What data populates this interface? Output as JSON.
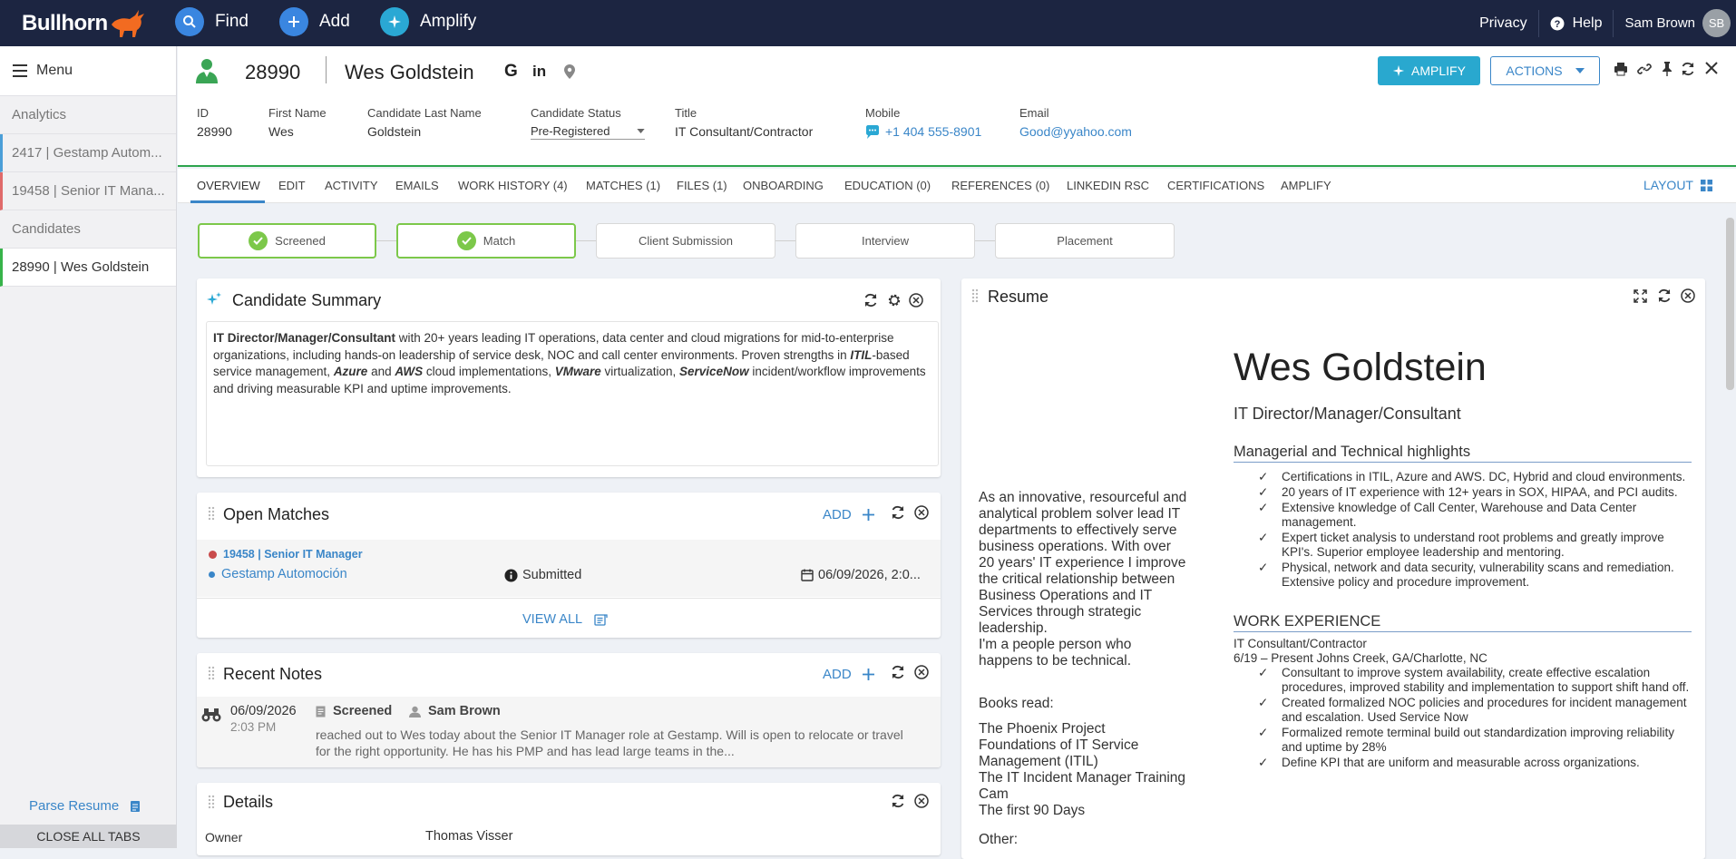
{
  "topbar": {
    "logo": "Bullhorn",
    "find": "Find",
    "add": "Add",
    "amplify": "Amplify",
    "privacy": "Privacy",
    "help": "Help",
    "user_name": "Sam Brown",
    "user_initials": "SB"
  },
  "sidebar": {
    "menu": "Menu",
    "items": [
      {
        "label": "Analytics"
      },
      {
        "label": "2417 | Gestamp Autom..."
      },
      {
        "label": "19458 | Senior IT Mana..."
      },
      {
        "label": "Candidates"
      },
      {
        "label": "28990 | Wes Goldstein"
      }
    ],
    "parse_resume": "Parse Resume",
    "close_all_tabs": "CLOSE ALL TABS"
  },
  "record": {
    "id": "28990",
    "name": "Wes Goldstein",
    "amplify_button": "AMPLIFY",
    "actions_button": "ACTIONS",
    "fields": [
      {
        "label": "ID",
        "value": "28990"
      },
      {
        "label": "First Name",
        "value": "Wes"
      },
      {
        "label": "Candidate Last Name",
        "value": "Goldstein"
      },
      {
        "label": "Candidate Status",
        "value": "Pre-Registered"
      },
      {
        "label": "Title",
        "value": "IT Consultant/Contractor"
      },
      {
        "label": "Mobile",
        "value": "+1 404 555-8901"
      },
      {
        "label": "Email",
        "value": "Good@yyahoo.com"
      }
    ]
  },
  "tabs": [
    {
      "label": "OVERVIEW"
    },
    {
      "label": "EDIT"
    },
    {
      "label": "ACTIVITY"
    },
    {
      "label": "EMAILS"
    },
    {
      "label": "WORK HISTORY (4)"
    },
    {
      "label": "MATCHES (1)"
    },
    {
      "label": "FILES (1)"
    },
    {
      "label": "ONBOARDING"
    },
    {
      "label": "EDUCATION (0)"
    },
    {
      "label": "REFERENCES (0)"
    },
    {
      "label": "LINKEDIN RSC"
    },
    {
      "label": "CERTIFICATIONS"
    },
    {
      "label": "AMPLIFY"
    }
  ],
  "layout_label": "LAYOUT",
  "pipeline": [
    {
      "label": "Screened",
      "done": true
    },
    {
      "label": "Match",
      "done": true
    },
    {
      "label": "Client Submission",
      "done": false
    },
    {
      "label": "Interview",
      "done": false
    },
    {
      "label": "Placement",
      "done": false
    }
  ],
  "summary": {
    "title": "Candidate Summary",
    "t1": "IT Director/Manager/Consultant",
    "t2": " with 20+ years leading IT operations, data center and cloud migrations for mid-to-enterprise organizations, including hands-on leadership of service desk, NOC and call center environments. Proven strengths in ",
    "t3": "ITIL",
    "t4": "-based service management, ",
    "t5": "Azure",
    "t6": " and ",
    "t7": "AWS",
    "t8": " cloud implementations, ",
    "t9": "VMware",
    "t10": " virtualization, ",
    "t11": "ServiceNow",
    "t12": " incident/workflow improvements and driving measurable KPI and uptime improvements."
  },
  "matches": {
    "title": "Open Matches",
    "add": "ADD",
    "job": "19458 | Senior IT Manager",
    "company": "Gestamp Automoción",
    "status": "Submitted",
    "date": "06/09/2026, 2:0...",
    "view_all": "VIEW ALL"
  },
  "notes": {
    "title": "Recent Notes",
    "add": "ADD",
    "date": "06/09/2026",
    "time": "2:03 PM",
    "action": "Screened",
    "author": "Sam Brown",
    "body": "reached out to Wes today about the Senior IT Manager role at Gestamp.  Will is open to relocate or travel for the right opportunity.  He has his PMP and has lead large teams in the..."
  },
  "details": {
    "title": "Details",
    "owner_label": "Owner",
    "owner_value": "Thomas Visser"
  },
  "resume": {
    "title": "Resume",
    "name": "Wes Goldstein",
    "headline": "IT Director/Manager/Consultant",
    "left_lines": [
      "As an innovative, resourceful and",
      "analytical problem solver lead IT",
      "departments to effectively serve",
      "business operations. With over",
      "20 years' IT experience I improve",
      "the critical relationship between",
      "Business Operations and IT",
      "Services through strategic",
      "leadership.",
      "I'm a people person who",
      "happens to be technical."
    ],
    "books_label": "Books read:",
    "books": [
      "The Phoenix Project",
      "Foundations of IT Service",
      "Management (ITIL)",
      "The IT Incident Manager Training",
      "Cam",
      "The first 90 Days"
    ],
    "other_label": "Other:",
    "highlights_title": "Managerial and Technical highlights",
    "highlights": [
      "Certifications in ITIL, Azure and AWS. DC, Hybrid and cloud environments.",
      "20 years of IT experience with 12+ years in SOX, HIPAA, and PCI audits.",
      "Extensive knowledge of Call Center, Warehouse and Data Center management.",
      "Expert ticket analysis to understand root problems and greatly improve KPI's. Superior employee leadership and mentoring.",
      "Physical, network and data security, vulnerability scans and remediation. Extensive policy and procedure improvement."
    ],
    "work_title": "WORK EXPERIENCE",
    "job_title": "IT Consultant/Contractor",
    "job_dates": "6/19 – Present Johns Creek, GA/Charlotte, NC",
    "job_bullets": [
      "Consultant to improve system availability, create effective escalation procedures, improved stability and implementation to support shift hand off.",
      "Created formalized NOC policies and procedures for incident management and escalation. Used Service Now",
      "Formalized remote terminal build out standardization improving reliability and uptime by 28%",
      "Define KPI that are uniform and measurable across organizations."
    ],
    "tick": "✓"
  }
}
